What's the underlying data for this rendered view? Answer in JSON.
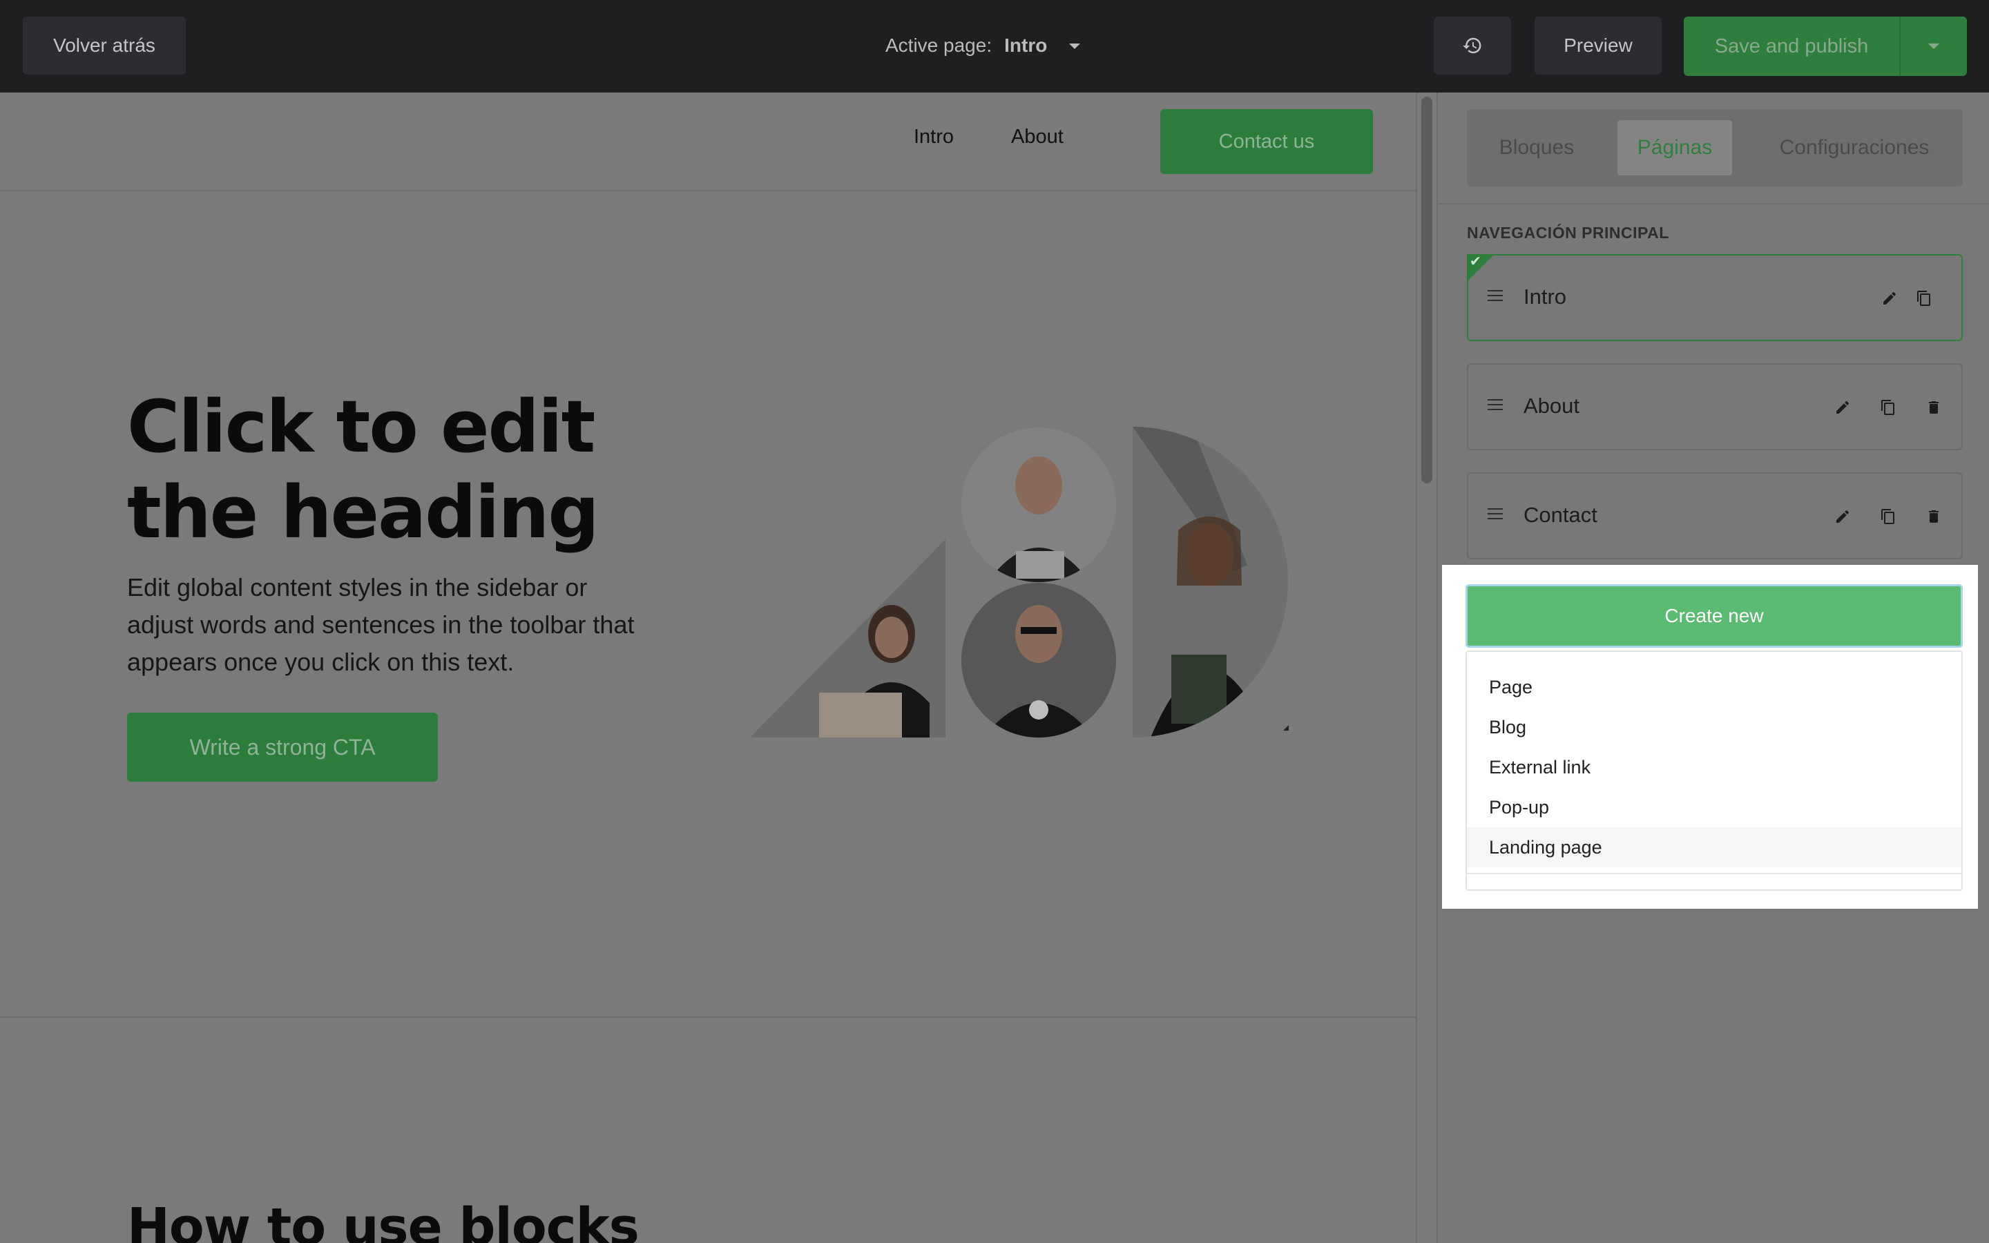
{
  "topbar": {
    "back_label": "Volver atrás",
    "active_page_label": "Active page:",
    "active_page_value": "Intro",
    "history_icon": "history-icon",
    "preview_label": "Preview",
    "publish_label": "Save and publish"
  },
  "site": {
    "nav": [
      "Intro",
      "About"
    ],
    "contact_label": "Contact us",
    "hero_heading": "Click to edit the heading",
    "hero_text": "Edit global content styles in the sidebar or adjust words and sentences in the toolbar that appears once you click on this text.",
    "cta_label": "Write a strong CTA",
    "section_heading": "How to use blocks"
  },
  "sidebar": {
    "tabs": [
      "Bloques",
      "Páginas",
      "Configuraciones"
    ],
    "active_tab": "Páginas",
    "section_label": "NAVEGACIÓN PRINCIPAL",
    "pages": [
      {
        "name": "Intro",
        "active": true
      },
      {
        "name": "About",
        "active": false
      },
      {
        "name": "Contact",
        "active": false
      }
    ]
  },
  "create_menu": {
    "button_label": "Create new",
    "options": [
      "Page",
      "Blog",
      "External link",
      "Pop-up",
      "Landing page"
    ],
    "hovered_option": "Landing page"
  },
  "colors": {
    "accent_green": "#5bbb72",
    "topbar": "#1e1f21"
  }
}
